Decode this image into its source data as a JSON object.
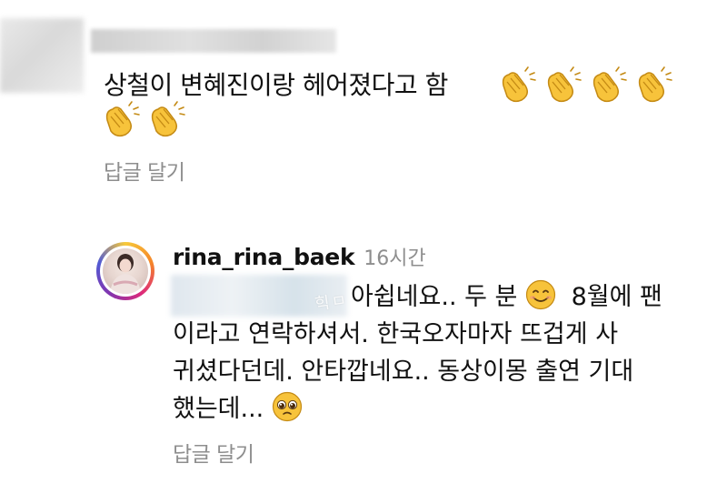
{
  "comment": {
    "text": "상철이  변혜진이랑 헤어졌다고 함",
    "reply_link_label": "답글 달기",
    "clap_emoji_count_line1": 4,
    "clap_emoji_count_line2": 2,
    "icon": "clapping-hands-emoji"
  },
  "reply": {
    "username": "rina_rina_baek",
    "time_ago": "16시간",
    "line1_text": "쉽네요.. 두 분",
    "line1_fragment": "아",
    "line1_after_emoji": "8월에 팬",
    "line2": "이라고 연락하셔서. 한국오자마자 뜨겁게 사",
    "line3": "귀셨다던데. 안타깝네요.. 동상이몽 출연 기대",
    "line4": "했는데...",
    "reply_link_label": "답글 달기",
    "emoji_smile": "smiling-face-emoji",
    "emoji_pleading": "pleading-face-emoji",
    "watermark": "힉ㅁ"
  },
  "colors": {
    "text": "#111111",
    "muted": "#8e8e8e",
    "emoji_yellow": "#f7c33b"
  }
}
